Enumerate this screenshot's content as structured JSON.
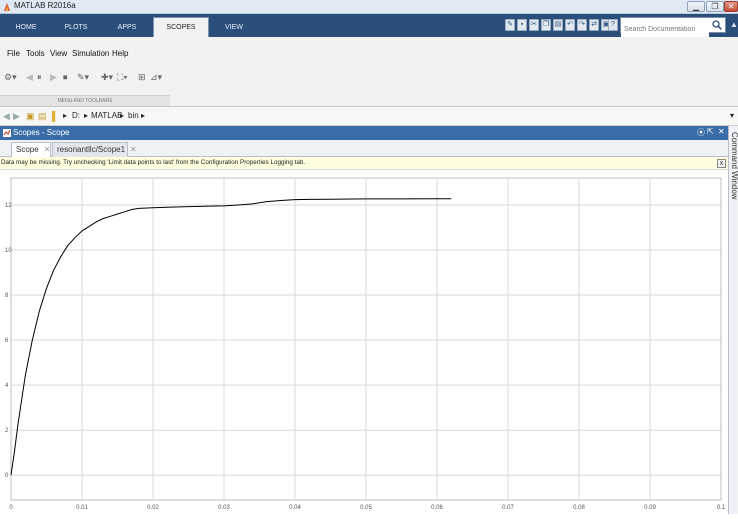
{
  "window": {
    "title": "MATLAB R2016a",
    "min": "▁",
    "restore": "❐",
    "close": "✕"
  },
  "ribbon_tabs": [
    {
      "label": "HOME"
    },
    {
      "label": "PLOTS"
    },
    {
      "label": "APPS"
    },
    {
      "label": "SCOPES"
    },
    {
      "label": "VIEW"
    }
  ],
  "search": {
    "placeholder": "Search Documentation"
  },
  "menus": [
    "File",
    "Tools",
    "View",
    "Simulation",
    "Help"
  ],
  "toolbar_section_label": "MENU AND TOOLBARS",
  "path": {
    "drive": "D:",
    "folder1": "MATLAB",
    "folder2": "bin"
  },
  "scopes_panel": {
    "title": "Scopes - Scope",
    "tabs": [
      "Scope",
      "resonantllc/Scope1"
    ]
  },
  "info_message": "Data may be missing.  Try unchecking 'Limit data points to last' from the Configuration Properties Logging tab.",
  "info_close": "x",
  "side_panel": "Command Window",
  "colors": {
    "tabstrip": "#2b4f7b",
    "scopes_header": "#3a6da8",
    "trace": "#000000",
    "grid": "#d9d9d9"
  },
  "chart_data": {
    "type": "line",
    "title": "",
    "xlabel": "",
    "ylabel": "",
    "xlim": [
      0,
      0.1
    ],
    "ylim": [
      -1.1,
      13.2
    ],
    "grid": true,
    "xticks": [
      "0",
      "0.01",
      "0.02",
      "0.03",
      "0.04",
      "0.05",
      "0.06",
      "0.07",
      "0.08",
      "0.09",
      "0.1"
    ],
    "yticks": [
      "0",
      "2",
      "4",
      "6",
      "8",
      "10",
      "12"
    ],
    "series": [
      {
        "x": [
          0,
          0.0005,
          0.001,
          0.002,
          0.003,
          0.004,
          0.005,
          0.006,
          0.007,
          0.008,
          0.009,
          0.01,
          0.011,
          0.012,
          0.013,
          0.014,
          0.015,
          0.016,
          0.017,
          0.018,
          0.02,
          0.022,
          0.025,
          0.028,
          0.03,
          0.032,
          0.034,
          0.036,
          0.038,
          0.04,
          0.042,
          0.045,
          0.05,
          0.055,
          0.06,
          0.062
        ],
        "y": [
          0,
          1.1,
          2.3,
          4.4,
          6.0,
          7.3,
          8.3,
          9.1,
          9.7,
          10.2,
          10.55,
          10.85,
          11.05,
          11.25,
          11.4,
          11.5,
          11.6,
          11.7,
          11.8,
          11.85,
          11.88,
          11.9,
          11.93,
          11.95,
          11.96,
          12.0,
          12.05,
          12.15,
          12.2,
          12.24,
          12.25,
          12.26,
          12.27,
          12.27,
          12.28,
          12.28
        ]
      }
    ]
  }
}
